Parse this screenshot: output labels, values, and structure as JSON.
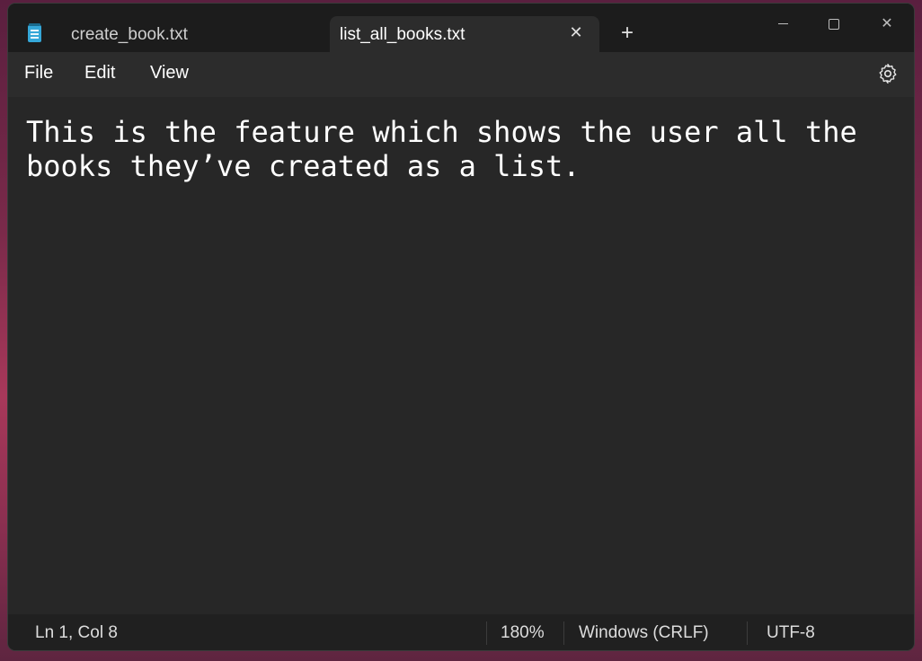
{
  "tabs": [
    {
      "label": "create_book.txt",
      "active": false
    },
    {
      "label": "list_all_books.txt",
      "active": true
    }
  ],
  "tab_controls": {
    "close_glyph": "✕",
    "new_tab_glyph": "+"
  },
  "window_controls": {
    "minimize_icon": "minimize-icon",
    "maximize_icon": "maximize-icon",
    "close_glyph": "✕"
  },
  "menu": {
    "file": "File",
    "edit": "Edit",
    "view": "View"
  },
  "editor": {
    "text": "This is the feature which shows the user all the books they’ve created as a list."
  },
  "status": {
    "position": "Ln 1, Col 8",
    "zoom": "180%",
    "line_ending": "Windows (CRLF)",
    "encoding": "UTF-8"
  },
  "colors": {
    "background": "#272727",
    "titlebar": "#1c1c1c",
    "active_tab": "#2c2c2c",
    "text": "#ffffff"
  }
}
